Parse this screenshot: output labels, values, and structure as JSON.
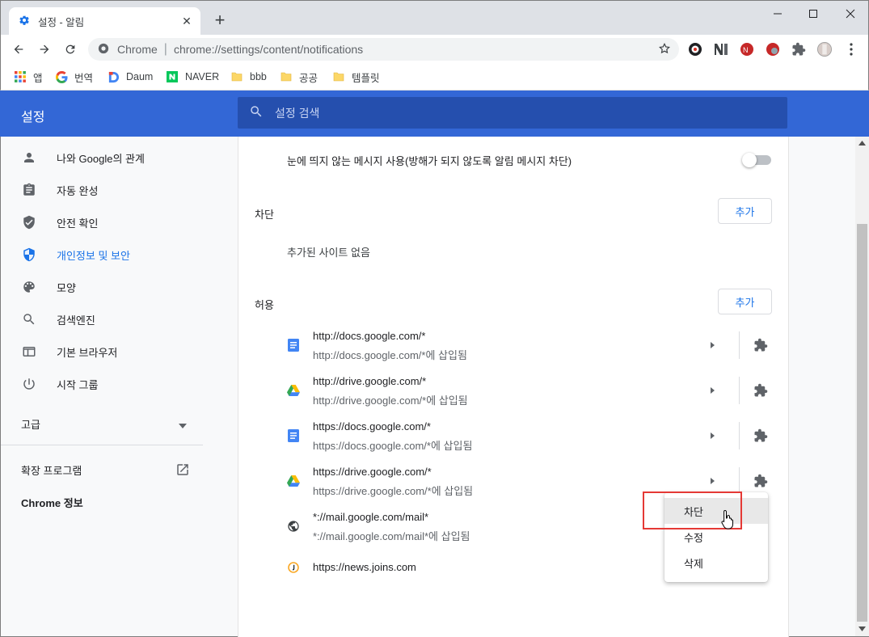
{
  "browser": {
    "tab": {
      "title": "설정 - 알림"
    },
    "address": {
      "site_label": "Chrome",
      "url": "chrome://settings/content/notifications"
    },
    "bookmarks": [
      {
        "label": "앱",
        "icon": "apps-grid-icon"
      },
      {
        "label": "번역",
        "icon": "google-g-icon"
      },
      {
        "label": "Daum",
        "icon": "daum-icon"
      },
      {
        "label": "NAVER",
        "icon": "naver-icon"
      },
      {
        "label": "bbb",
        "icon": "folder-icon"
      },
      {
        "label": "공공",
        "icon": "folder-icon"
      },
      {
        "label": "템플릿",
        "icon": "folder-icon"
      }
    ]
  },
  "settings": {
    "header_title": "설정",
    "search_placeholder": "설정 검색",
    "nav": [
      {
        "label": "나와 Google의 관계",
        "icon": "person-icon"
      },
      {
        "label": "자동 완성",
        "icon": "clipboard-icon"
      },
      {
        "label": "안전 확인",
        "icon": "shield-check-icon"
      },
      {
        "label": "개인정보 및 보안",
        "icon": "shield-icon",
        "active": true
      },
      {
        "label": "모양",
        "icon": "palette-icon"
      },
      {
        "label": "검색엔진",
        "icon": "search-icon"
      },
      {
        "label": "기본 브라우저",
        "icon": "browser-icon"
      },
      {
        "label": "시작 그룹",
        "icon": "power-icon"
      }
    ],
    "advanced_label": "고급",
    "extensions_label": "확장 프로그램",
    "about_label": "Chrome 정보"
  },
  "content": {
    "quiet_messages": {
      "label": "눈에 띄지 않는 메시지 사용(방해가 되지 않도록 알림 메시지 차단)",
      "enabled": false
    },
    "block": {
      "title": "차단",
      "add_label": "추가",
      "empty_text": "추가된 사이트 없음"
    },
    "allow": {
      "title": "허용",
      "add_label": "추가",
      "sites": [
        {
          "url": "http://docs.google.com/*",
          "sub": "http://docs.google.com/*에 삽입됨",
          "icon": "google-docs-icon"
        },
        {
          "url": "http://drive.google.com/*",
          "sub": "http://drive.google.com/*에 삽입됨",
          "icon": "google-drive-icon"
        },
        {
          "url": "https://docs.google.com/*",
          "sub": "https://docs.google.com/*에 삽입됨",
          "icon": "google-docs-icon"
        },
        {
          "url": "https://drive.google.com/*",
          "sub": "https://drive.google.com/*에 삽입됨",
          "icon": "google-drive-icon"
        },
        {
          "url": "*://mail.google.com/mail*",
          "sub": "*://mail.google.com/mail*에 삽입됨",
          "icon": "globe-icon"
        },
        {
          "url": "https://news.joins.com",
          "sub": "",
          "icon": "joins-icon"
        }
      ]
    },
    "context_menu": {
      "items": [
        "차단",
        "수정",
        "삭제"
      ]
    }
  },
  "colors": {
    "header_blue": "#3367d6",
    "search_bg": "#254fae",
    "accent": "#1a73e8",
    "highlight_box": "#e53935"
  }
}
